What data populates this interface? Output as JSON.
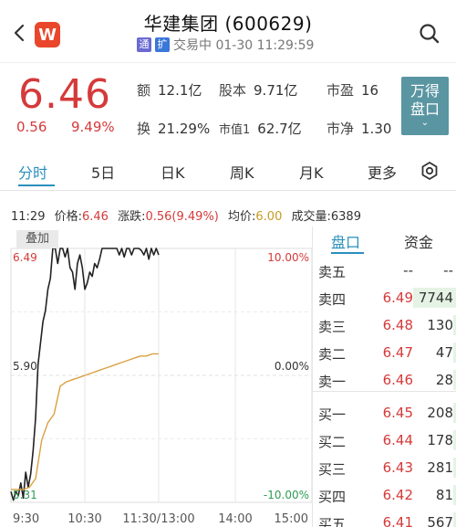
{
  "header": {
    "title": "华建集团 (600629)",
    "tag_tong": "通",
    "tag_kuo": "扩",
    "status": "交易中 01-30 11:29:59",
    "logo_letter": "W"
  },
  "quote": {
    "price": "6.46",
    "change": "0.56",
    "change_pct": "9.49%",
    "amount_label": "额",
    "amount": "12.1亿",
    "shares_label": "股本",
    "shares": "9.71亿",
    "pe_label": "市盈",
    "pe": "16",
    "turnover_label": "换",
    "turnover": "21.29%",
    "mktcap_label": "市值1",
    "mktcap": "62.7亿",
    "pb_label": "市净",
    "pb": "1.30",
    "wande_line1": "万得",
    "wande_line2": "盘口",
    "wande_chevron": "⌄"
  },
  "tabs": [
    "分时",
    "5日",
    "日K",
    "周K",
    "月K",
    "更多"
  ],
  "info": {
    "time": "11:29",
    "price_label": "价格:",
    "price": "6.46",
    "change_label": "涨跌:",
    "change": "0.56(9.49%)",
    "avg_label": "均价:",
    "avg": "6.00",
    "volume_label": "成交量:",
    "volume": "6389"
  },
  "chart_data": {
    "type": "line",
    "title": "",
    "xlabel": "",
    "ylabel": "",
    "x_ticks": [
      "9:30",
      "10:30",
      "11:30/13:00",
      "14:00",
      "15:00"
    ],
    "ylim": [
      5.31,
      6.49
    ],
    "y_left_ticks": [
      "6.49",
      "5.90",
      "5.31"
    ],
    "y_right_ticks": [
      "10.00%",
      "0.00%",
      "-10.00%"
    ],
    "overlay_button": "叠加",
    "series": [
      {
        "color": "#222222",
        "x_minutes": [
          0,
          2,
          4,
          6,
          8,
          10,
          12,
          14,
          16,
          18,
          20,
          22,
          24,
          26,
          28,
          30,
          32,
          34,
          36,
          38,
          40,
          42,
          44,
          46,
          48,
          50,
          52,
          54,
          56,
          58,
          60,
          62,
          64,
          66,
          68,
          70,
          72,
          74,
          76,
          78,
          80,
          82,
          84,
          86,
          88,
          90,
          92,
          94,
          96,
          98,
          100,
          102,
          104,
          106,
          108,
          110,
          112,
          114,
          116,
          118,
          120
        ],
        "values": [
          5.36,
          5.32,
          5.36,
          5.34,
          5.4,
          5.33,
          5.45,
          5.38,
          5.44,
          5.55,
          5.7,
          5.95,
          6.05,
          6.15,
          6.2,
          6.3,
          6.35,
          6.49,
          6.49,
          6.42,
          6.49,
          6.49,
          6.45,
          6.49,
          6.4,
          6.38,
          6.3,
          6.42,
          6.46,
          6.4,
          6.3,
          6.33,
          6.38,
          6.36,
          6.42,
          6.4,
          6.44,
          6.49,
          6.49,
          6.49,
          6.49,
          6.49,
          6.49,
          6.49,
          6.46,
          6.49,
          6.45,
          6.49,
          6.49,
          6.46,
          6.49,
          6.49,
          6.49,
          6.48,
          6.46,
          6.49,
          6.44,
          6.49,
          6.46,
          6.49,
          6.46
        ]
      },
      {
        "color": "#d9a040",
        "x_minutes": [
          0,
          5,
          10,
          15,
          20,
          25,
          30,
          35,
          40,
          45,
          50,
          55,
          60,
          65,
          70,
          75,
          80,
          85,
          90,
          95,
          100,
          105,
          110,
          115,
          120
        ],
        "values": [
          5.37,
          5.37,
          5.37,
          5.38,
          5.42,
          5.6,
          5.68,
          5.72,
          5.85,
          5.87,
          5.88,
          5.89,
          5.9,
          5.91,
          5.92,
          5.93,
          5.94,
          5.95,
          5.96,
          5.97,
          5.98,
          5.99,
          5.99,
          6.0,
          6.0
        ]
      }
    ]
  },
  "book": {
    "tab_active": "盘口",
    "tab_other": "资金",
    "sells": [
      {
        "label": "卖五",
        "price": "--",
        "volume": "--",
        "vol_frac": 0
      },
      {
        "label": "卖四",
        "price": "6.49",
        "volume": "7744",
        "vol_frac": 1.0
      },
      {
        "label": "卖三",
        "price": "6.48",
        "volume": "130",
        "vol_frac": 0.02
      },
      {
        "label": "卖二",
        "price": "6.47",
        "volume": "47",
        "vol_frac": 0.01
      },
      {
        "label": "卖一",
        "price": "6.46",
        "volume": "28",
        "vol_frac": 0.01
      }
    ],
    "buys": [
      {
        "label": "买一",
        "price": "6.45",
        "volume": "208",
        "vol_frac": 0.03
      },
      {
        "label": "买二",
        "price": "6.44",
        "volume": "178",
        "vol_frac": 0.02
      },
      {
        "label": "买三",
        "price": "6.43",
        "volume": "281",
        "vol_frac": 0.04
      },
      {
        "label": "买四",
        "price": "6.42",
        "volume": "81",
        "vol_frac": 0.01
      },
      {
        "label": "买五",
        "price": "6.41",
        "volume": "567",
        "vol_frac": 0.07
      }
    ]
  },
  "colors": {
    "red": "#d53a3a",
    "accent": "#2a8fbd",
    "avg_line": "#d9a040"
  }
}
